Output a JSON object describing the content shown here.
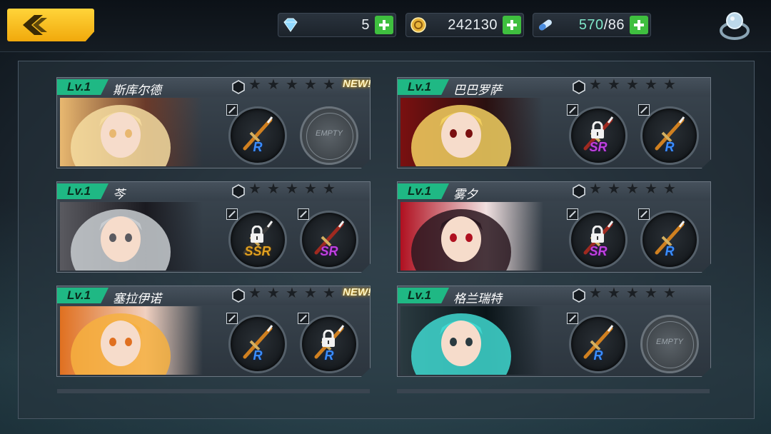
{
  "resources": {
    "gems": {
      "icon": "diamond-icon",
      "value": "5"
    },
    "gold": {
      "icon": "gold-coin-icon",
      "value": "242130"
    },
    "stamina": {
      "icon": "energy-capsule-icon",
      "current": "570",
      "max": "/86"
    }
  },
  "slot_empty_label": "EMPTY",
  "new_label": "NEW!",
  "colors": {
    "accent": "#ffc820",
    "level_badge": "#1fb884",
    "plus": "#3fbf3f",
    "rarity_R": "#3a8dff",
    "rarity_SR": "#c040e0",
    "rarity_SSR": "#e0a020"
  },
  "characters": [
    {
      "level": "Lv.1",
      "name": "斯库尔德",
      "is_new": true,
      "stars": 5,
      "slots": [
        {
          "rarity": "R",
          "locked": false
        },
        {
          "empty": true
        }
      ]
    },
    {
      "level": "Lv.1",
      "name": "巴巴罗萨",
      "is_new": false,
      "stars": 5,
      "slots": [
        {
          "rarity": "SR",
          "locked": true
        },
        {
          "rarity": "R",
          "locked": false
        }
      ]
    },
    {
      "level": "Lv.1",
      "name": "芩",
      "is_new": false,
      "stars": 5,
      "slots": [
        {
          "rarity": "SSR",
          "locked": true
        },
        {
          "rarity": "SR",
          "locked": false
        }
      ]
    },
    {
      "level": "Lv.1",
      "name": "雾夕",
      "is_new": false,
      "stars": 5,
      "slots": [
        {
          "rarity": "SR",
          "locked": true
        },
        {
          "rarity": "R",
          "locked": false
        }
      ]
    },
    {
      "level": "Lv.1",
      "name": "塞拉伊诺",
      "is_new": true,
      "stars": 5,
      "slots": [
        {
          "rarity": "R",
          "locked": false
        },
        {
          "rarity": "R",
          "locked": true
        }
      ]
    },
    {
      "level": "Lv.1",
      "name": "格兰瑞特",
      "is_new": false,
      "stars": 5,
      "slots": [
        {
          "rarity": "R",
          "locked": false
        },
        {
          "empty": true
        }
      ]
    }
  ]
}
